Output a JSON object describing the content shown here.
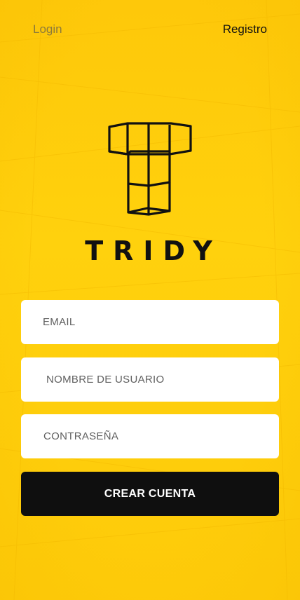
{
  "nav": {
    "login_label": "Login",
    "register_label": "Registro"
  },
  "brand": {
    "name": "TRIDY",
    "logo_icon": "tridy-cube-t-logo"
  },
  "form": {
    "email_placeholder": "EMAIL",
    "username_placeholder": "NOMBRE DE USUARIO",
    "password_placeholder": "CONTRASEÑA",
    "submit_label": "CREAR CUENTA"
  },
  "colors": {
    "background": "#fece0a",
    "text_dark": "#111111",
    "nav_inactive": "#8d7a3a",
    "button": "#0f0f0f",
    "field": "#ffffff"
  }
}
